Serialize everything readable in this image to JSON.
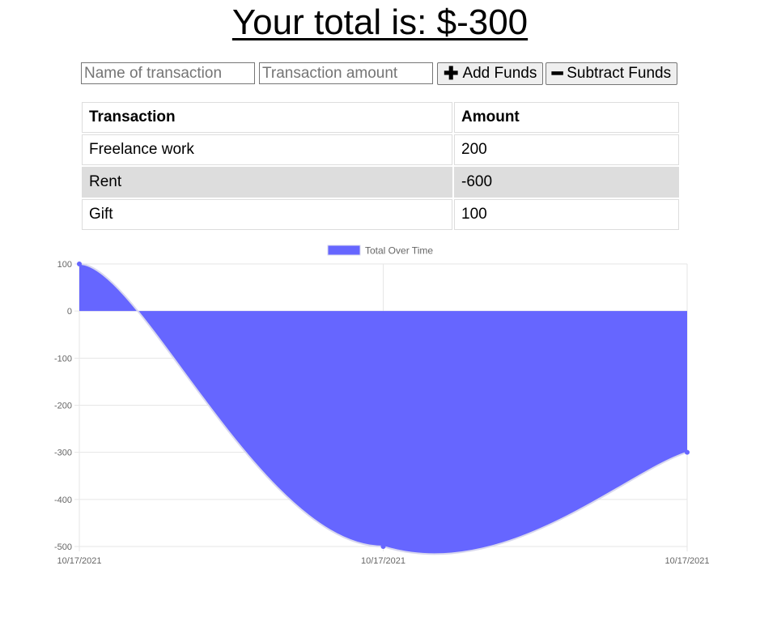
{
  "total": {
    "text": "Your total is: $-300"
  },
  "form": {
    "name_placeholder": "Name of transaction",
    "amount_placeholder": "Transaction amount",
    "add_label": "Add Funds",
    "add_icon": "plus-icon",
    "subtract_label": "Subtract Funds",
    "subtract_icon": "minus-icon"
  },
  "table": {
    "headers": [
      "Transaction",
      "Amount"
    ],
    "rows": [
      [
        "Freelance work",
        "200"
      ],
      [
        "Rent",
        "-600"
      ],
      [
        "Gift",
        "100"
      ]
    ]
  },
  "colors": {
    "fill": "#6666ff",
    "point": "#6666ff",
    "grid": "#e6e6e6"
  },
  "chart_data": {
    "type": "area",
    "legend": "Total Over Time",
    "legend_position": "top-center",
    "x": [
      "10/17/2021",
      "10/17/2021",
      "10/17/2021"
    ],
    "series": [
      {
        "name": "Total Over Time",
        "values": [
          100,
          -500,
          -300
        ]
      }
    ],
    "yticks": [
      100,
      0,
      -100,
      -200,
      -300,
      -400,
      -500
    ],
    "ylim": [
      -500,
      100
    ],
    "grid": true
  }
}
